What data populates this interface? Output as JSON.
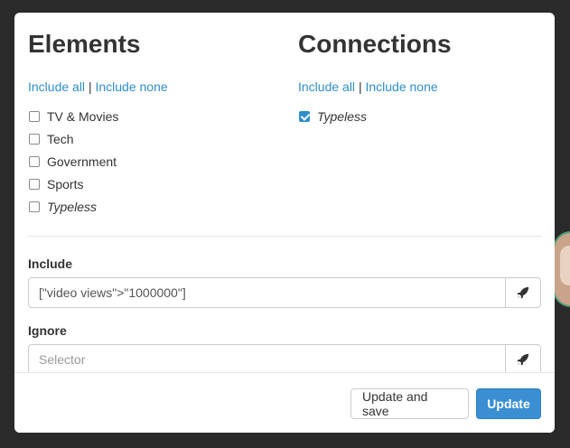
{
  "elements": {
    "title": "Elements",
    "include_all": "Include all",
    "separator": "|",
    "include_none": "Include none",
    "items": [
      {
        "label": "TV & Movies",
        "checked": false,
        "italic": false
      },
      {
        "label": "Tech",
        "checked": false,
        "italic": false
      },
      {
        "label": "Government",
        "checked": false,
        "italic": false
      },
      {
        "label": "Sports",
        "checked": false,
        "italic": false
      },
      {
        "label": "Typeless",
        "checked": false,
        "italic": true
      }
    ]
  },
  "connections": {
    "title": "Connections",
    "include_all": "Include all",
    "separator": "|",
    "include_none": "Include none",
    "items": [
      {
        "label": "Typeless",
        "checked": true,
        "italic": true
      }
    ]
  },
  "include": {
    "label": "Include",
    "value": "[\"video views\">\"1000000\"]",
    "placeholder": "Selector",
    "button_icon": "rocket-icon"
  },
  "ignore": {
    "label": "Ignore",
    "value": "",
    "placeholder": "Selector",
    "button_icon": "rocket-icon"
  },
  "footer": {
    "update_and_save": "Update and save",
    "update": "Update"
  },
  "colors": {
    "link": "#2f8ecb",
    "primary": "#3a8fd3",
    "backdrop": "#2a2a2a"
  }
}
